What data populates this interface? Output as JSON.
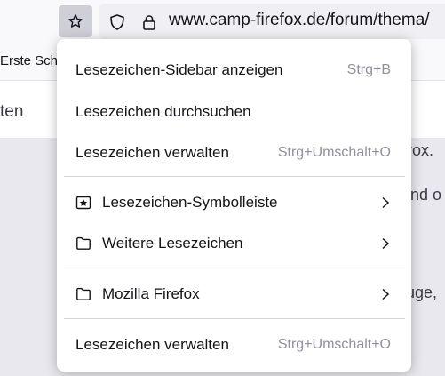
{
  "toolbar": {
    "url": "www.camp-firefox.de/forum/thema/"
  },
  "bookmarks_bar": {
    "first_item": "Erste Sch"
  },
  "page": {
    "card_text": "ten",
    "fragments": [
      "rox.",
      "nd o",
      "uge,"
    ]
  },
  "menu": {
    "show_sidebar": {
      "label": "Lesezeichen-Sidebar anzeigen",
      "shortcut": "Strg+B"
    },
    "search": {
      "label": "Lesezeichen durchsuchen"
    },
    "manage_top": {
      "label": "Lesezeichen verwalten",
      "shortcut": "Strg+Umschalt+O"
    },
    "toolbar_folder": {
      "label": "Lesezeichen-Symbolleiste",
      "icon": "star-folder-icon"
    },
    "other_folder": {
      "label": "Weitere Lesezeichen",
      "icon": "folder-icon"
    },
    "firefox_folder": {
      "label": "Mozilla Firefox",
      "icon": "folder-icon"
    },
    "manage_bottom": {
      "label": "Lesezeichen verwalten",
      "shortcut": "Strg+Umschalt+O"
    }
  }
}
